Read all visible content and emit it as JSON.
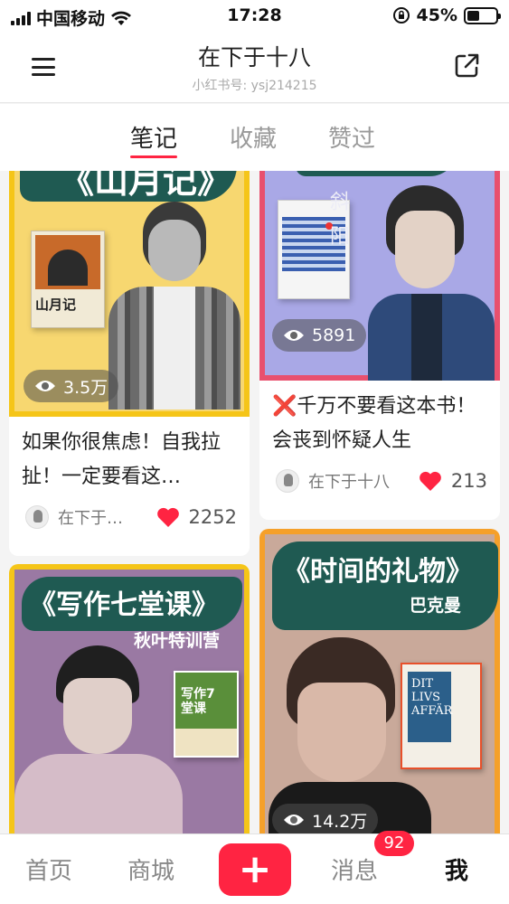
{
  "status_bar": {
    "carrier": "中国移动",
    "time": "17:28",
    "battery": "45%",
    "battery_level": 0.45
  },
  "header": {
    "title": "在下于十八",
    "subtitle": "小红书号: ysj214215"
  },
  "tabs": [
    {
      "label": "笔记"
    },
    {
      "label": "收藏"
    },
    {
      "label": "赞过"
    }
  ],
  "notes": [
    {
      "cover_text": "《山月记》",
      "book_cover_text": "山月记",
      "views": "3.5万",
      "title": "如果你很焦虑！自我拉扯！一定要看这…",
      "author": "在下于…",
      "likes": "2252"
    },
    {
      "cover_text": "斜阳",
      "views": "5891",
      "title": "❌千万不要看这本书！会丧到怀疑人生",
      "author": "在下于十八",
      "likes": "213"
    },
    {
      "cover_text": "《写作七堂课》",
      "cover_subtitle": "秋叶特训营",
      "book_cover_text": "写作7堂课",
      "views": "",
      "title": "",
      "author": "",
      "likes": ""
    },
    {
      "cover_text": "《时间的礼物》",
      "cover_subtitle": "巴克曼",
      "book_cover_text": "DIT LIVS AFFÄR",
      "views": "14.2万",
      "title": "",
      "author": "",
      "likes": ""
    }
  ],
  "bottom_nav": {
    "home": "首页",
    "mall": "商城",
    "messages": "消息",
    "messages_badge": "92",
    "me": "我"
  },
  "colors": {
    "accent": "#ff2442",
    "brush_green": "#1f5a52",
    "card_yellow_border": "#f5c518",
    "card_pink_border": "#e8506e",
    "card_orange_border": "#f5a02a"
  }
}
